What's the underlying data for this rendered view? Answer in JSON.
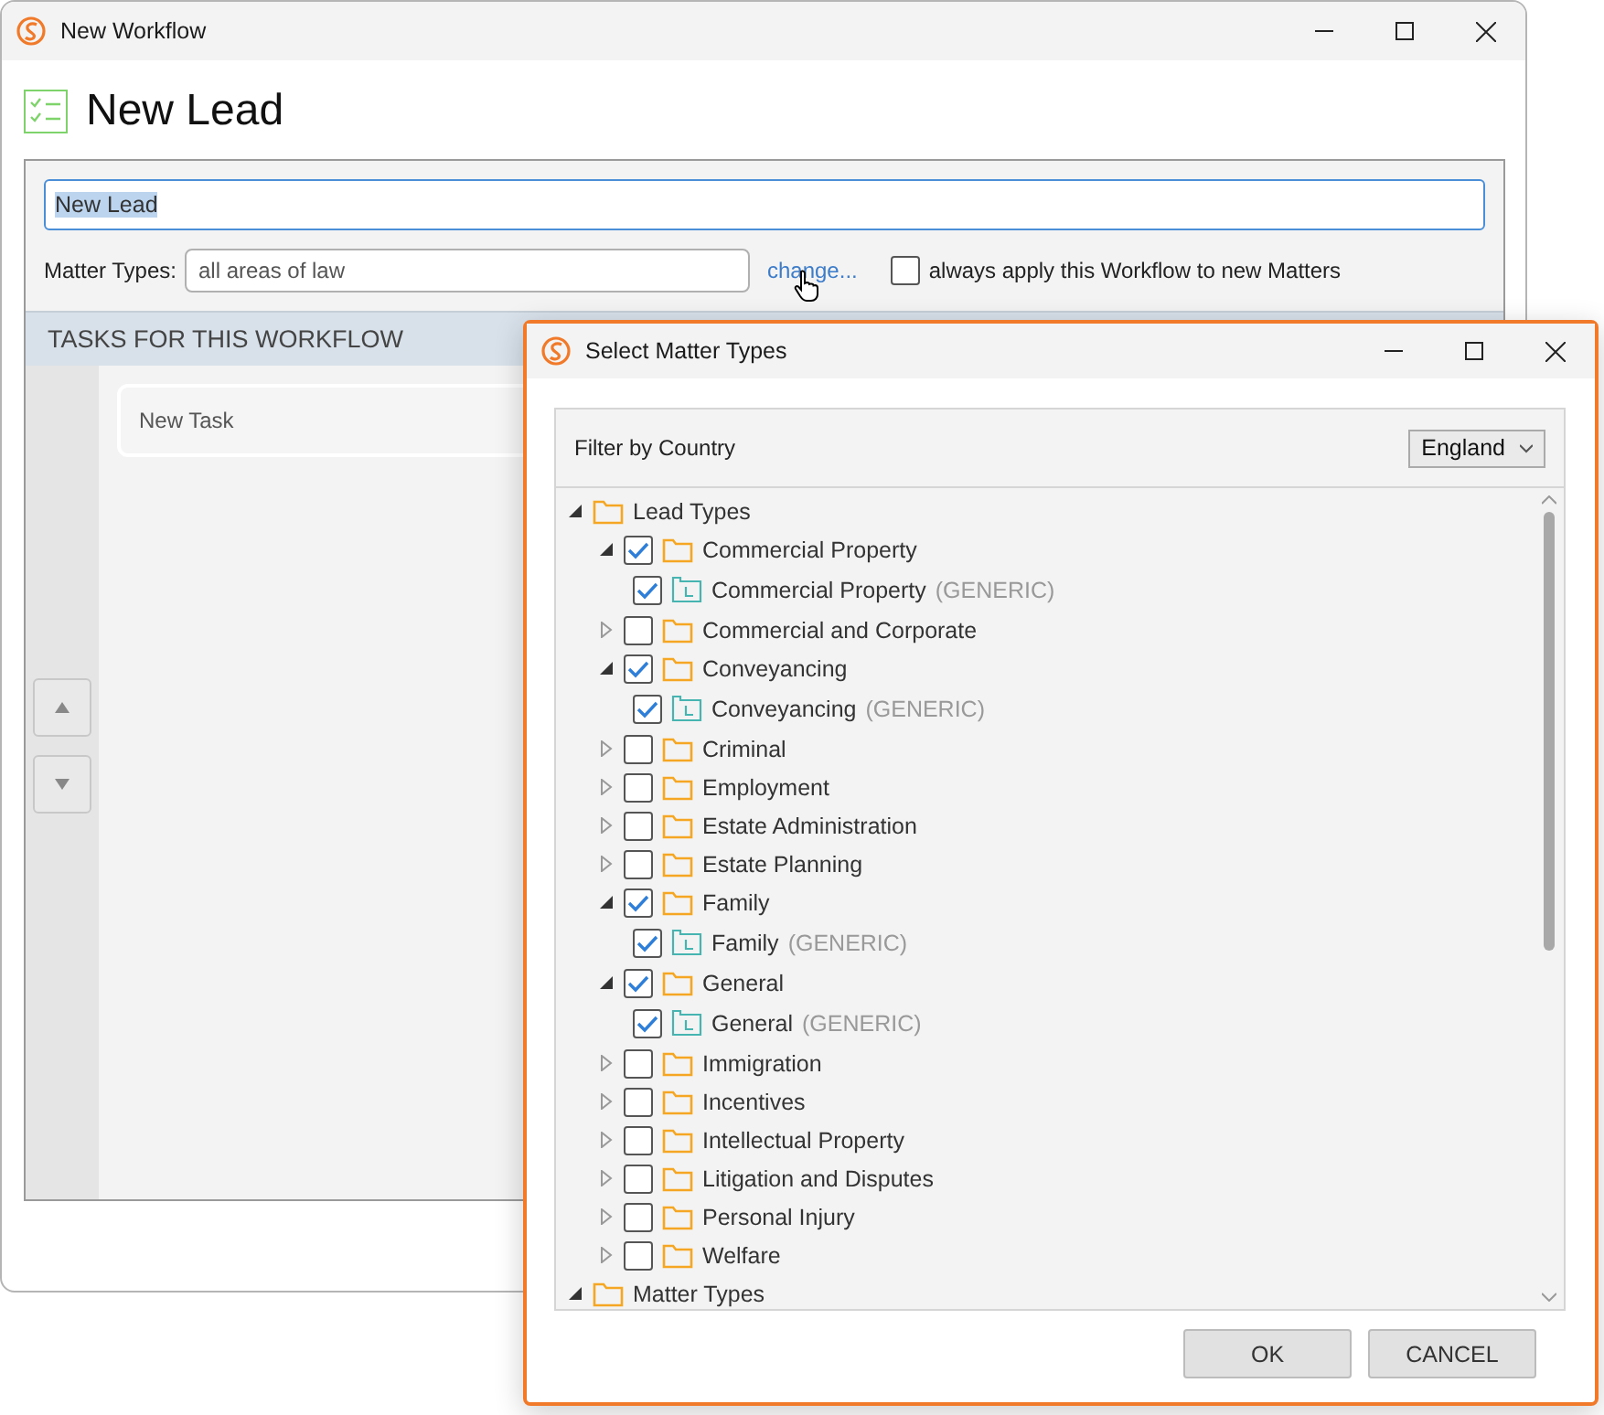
{
  "main_window": {
    "title": "New Workflow",
    "heading": "New Lead",
    "name_field": {
      "value": "New Lead",
      "text_selected": true
    },
    "matter_types": {
      "label": "Matter Types:",
      "value": "all areas of law",
      "link": "change...",
      "always_apply": {
        "label": "always apply this Workflow to new Matters",
        "checked": false
      }
    },
    "tasks": {
      "header": "TASKS FOR THIS WORKFLOW",
      "items": [
        {
          "label": "New Task"
        }
      ]
    }
  },
  "dialog": {
    "title": "Select Matter Types",
    "filter_label": "Filter by Country",
    "country": "England",
    "tree": [
      {
        "label": "Lead Types",
        "kind": "root",
        "expanded": true,
        "children": [
          {
            "label": "Commercial Property",
            "kind": "category",
            "checked": true,
            "expanded": true,
            "children": [
              {
                "label": "Commercial Property",
                "suffix": "(GENERIC)",
                "kind": "type",
                "checked": true
              }
            ]
          },
          {
            "label": "Commercial and Corporate",
            "kind": "category",
            "checked": false,
            "expanded": false
          },
          {
            "label": "Conveyancing",
            "kind": "category",
            "checked": true,
            "expanded": true,
            "children": [
              {
                "label": "Conveyancing",
                "suffix": "(GENERIC)",
                "kind": "type",
                "checked": true
              }
            ]
          },
          {
            "label": "Criminal",
            "kind": "category",
            "checked": false,
            "expanded": false
          },
          {
            "label": "Employment",
            "kind": "category",
            "checked": false,
            "expanded": false
          },
          {
            "label": "Estate Administration",
            "kind": "category",
            "checked": false,
            "expanded": false
          },
          {
            "label": "Estate Planning",
            "kind": "category",
            "checked": false,
            "expanded": false
          },
          {
            "label": "Family",
            "kind": "category",
            "checked": true,
            "expanded": true,
            "children": [
              {
                "label": "Family",
                "suffix": "(GENERIC)",
                "kind": "type",
                "checked": true
              }
            ]
          },
          {
            "label": "General",
            "kind": "category",
            "checked": true,
            "expanded": true,
            "children": [
              {
                "label": "General",
                "suffix": "(GENERIC)",
                "kind": "type",
                "checked": true
              }
            ]
          },
          {
            "label": "Immigration",
            "kind": "category",
            "checked": false,
            "expanded": false
          },
          {
            "label": "Incentives",
            "kind": "category",
            "checked": false,
            "expanded": false
          },
          {
            "label": "Intellectual Property",
            "kind": "category",
            "checked": false,
            "expanded": false
          },
          {
            "label": "Litigation and Disputes",
            "kind": "category",
            "checked": false,
            "expanded": false
          },
          {
            "label": "Personal Injury",
            "kind": "category",
            "checked": false,
            "expanded": false
          },
          {
            "label": "Welfare",
            "kind": "category",
            "checked": false,
            "expanded": false
          }
        ]
      },
      {
        "label": "Matter Types",
        "kind": "root",
        "expanded": true
      }
    ],
    "buttons": [
      "OK",
      "CANCEL"
    ]
  }
}
